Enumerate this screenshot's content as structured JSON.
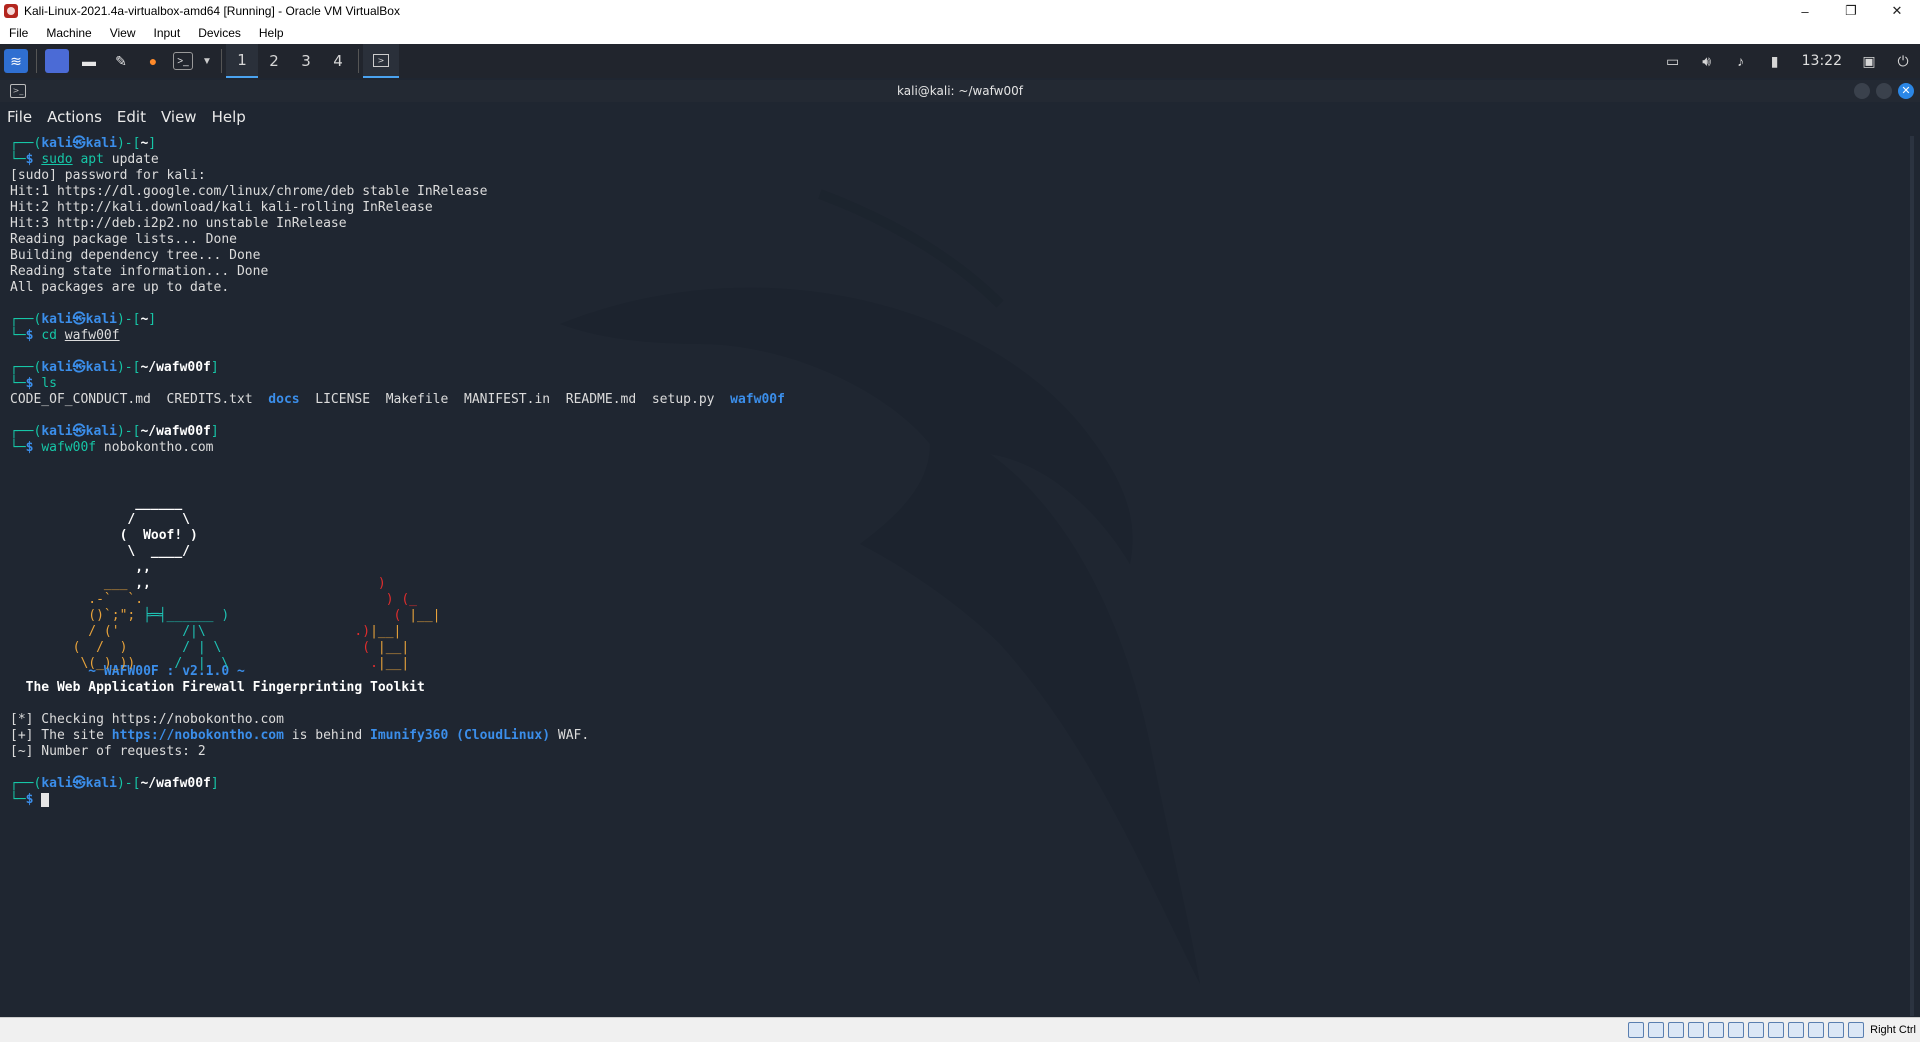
{
  "vbox": {
    "title": "Kali-Linux-2021.4a-virtualbox-amd64 [Running] - Oracle VM VirtualBox",
    "menu": [
      "File",
      "Machine",
      "View",
      "Input",
      "Devices",
      "Help"
    ],
    "window_controls": {
      "minimize": "–",
      "restore": "❐",
      "close": "✕"
    },
    "status_host_key": "Right Ctrl"
  },
  "panel": {
    "workspaces": [
      "1",
      "2",
      "3",
      "4"
    ],
    "active_workspace": "1",
    "clock": "13:22"
  },
  "terminal": {
    "title": "kali@kali: ~/wafw00f",
    "menu": [
      "File",
      "Actions",
      "Edit",
      "View",
      "Help"
    ],
    "user": "kali",
    "host": "kali",
    "cmd1": {
      "cwd": "~",
      "sudo": "sudo",
      "apt": "apt",
      "rest": " update"
    },
    "output1": [
      "[sudo] password for kali:",
      "Hit:1 https://dl.google.com/linux/chrome/deb stable InRelease",
      "Hit:2 http://kali.download/kali kali-rolling InRelease",
      "Hit:3 http://deb.i2p2.no unstable InRelease",
      "Reading package lists... Done",
      "Building dependency tree... Done",
      "Reading state information... Done",
      "All packages are up to date."
    ],
    "cmd2": {
      "cwd": "~",
      "cd": "cd",
      "arg": "wafw00f"
    },
    "cmd3": {
      "cwd": "~/wafw00f",
      "cmd": "ls"
    },
    "ls_output": [
      {
        "name": "CODE_OF_CONDUCT.md",
        "dir": false
      },
      {
        "name": "CREDITS.txt",
        "dir": false
      },
      {
        "name": "docs",
        "dir": true
      },
      {
        "name": "LICENSE",
        "dir": false
      },
      {
        "name": "Makefile",
        "dir": false
      },
      {
        "name": "MANIFEST.in",
        "dir": false
      },
      {
        "name": "README.md",
        "dir": false
      },
      {
        "name": "setup.py",
        "dir": false
      },
      {
        "name": "wafw00f",
        "dir": true
      }
    ],
    "cmd4": {
      "cwd": "~/wafw00f",
      "cmd": "wafw00f",
      "arg": " nobokontho.com"
    },
    "banner": {
      "version": "~ WAFW00F : v2.1.0 ~",
      "tagline": "The Web Application Firewall Fingerprinting Toolkit",
      "speech": "Woof!"
    },
    "result": {
      "checking_prefix": "[*] Checking ",
      "checking_url": "https://nobokontho.com",
      "found_prefix": "[+] The site ",
      "found_url": "https://nobokontho.com",
      "found_mid": " is behind ",
      "waf_name": "Imunify360 (CloudLinux)",
      "found_suffix": " WAF.",
      "requests": "[~] Number of requests: 2"
    },
    "cmd5": {
      "cwd": "~/wafw00f"
    }
  },
  "colors": {
    "terminal_bg": "#1f2631",
    "prompt_blue": "#3b8eea",
    "command_green": "#16c6a7",
    "dog_orange": "#e8a33b",
    "fire_red": "#e02d2d"
  }
}
